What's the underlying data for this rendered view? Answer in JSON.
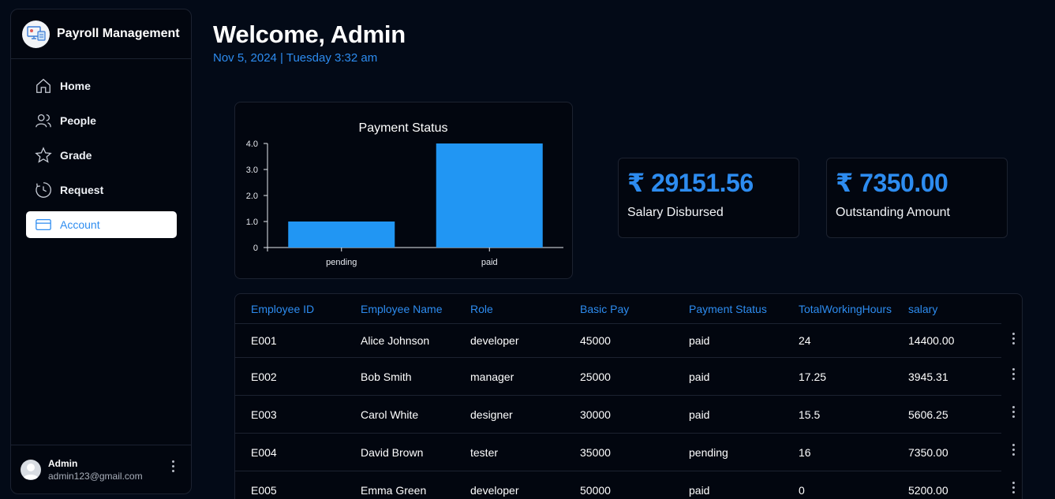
{
  "brand": {
    "title": "Payroll Management",
    "logo": "payroll-monitor-logo"
  },
  "nav": [
    {
      "label": "Home",
      "icon": "home-icon",
      "active": false
    },
    {
      "label": "People",
      "icon": "people-icon",
      "active": false
    },
    {
      "label": "Grade",
      "icon": "star-icon",
      "active": false
    },
    {
      "label": "Request",
      "icon": "clock-icon",
      "active": false
    },
    {
      "label": "Account",
      "icon": "card-icon",
      "active": true
    }
  ],
  "user": {
    "name": "Admin",
    "email": "admin123@gmail.com"
  },
  "header": {
    "title": "Welcome, Admin",
    "date": "Nov 5, 2024 | Tuesday 3:32 am"
  },
  "stats": [
    {
      "value": "₹ 29151.56",
      "label": "Salary Disbursed"
    },
    {
      "value": "₹ 7350.00",
      "label": "Outstanding Amount"
    }
  ],
  "colors": {
    "accent": "#2d8cf0",
    "bar": "#2196f3",
    "background": "#030a17"
  },
  "chart_data": {
    "type": "bar",
    "title": "Payment Status",
    "categories": [
      "pending",
      "paid"
    ],
    "values": [
      1,
      4
    ],
    "ylim": [
      0,
      4
    ],
    "yticks": [
      "0",
      "1.0",
      "2.0",
      "3.0",
      "4.0"
    ],
    "xlabel": "",
    "ylabel": "",
    "grid": false
  },
  "table": {
    "headers": [
      "Employee ID",
      "Employee Name",
      "Role",
      "Basic Pay",
      "Payment Status",
      "TotalWorkingHours",
      "salary"
    ],
    "rows": [
      [
        "E001",
        "Alice Johnson",
        "developer",
        "45000",
        "paid",
        "24",
        "14400.00"
      ],
      [
        "E002",
        "Bob Smith",
        "manager",
        "25000",
        "paid",
        "17.25",
        "3945.31"
      ],
      [
        "E003",
        "Carol White",
        "designer",
        "30000",
        "paid",
        "15.5",
        "5606.25"
      ],
      [
        "E004",
        "David Brown",
        "tester",
        "35000",
        "pending",
        "16",
        "7350.00"
      ],
      [
        "E005",
        "Emma Green",
        "developer",
        "50000",
        "paid",
        "0",
        "5200.00"
      ]
    ]
  }
}
